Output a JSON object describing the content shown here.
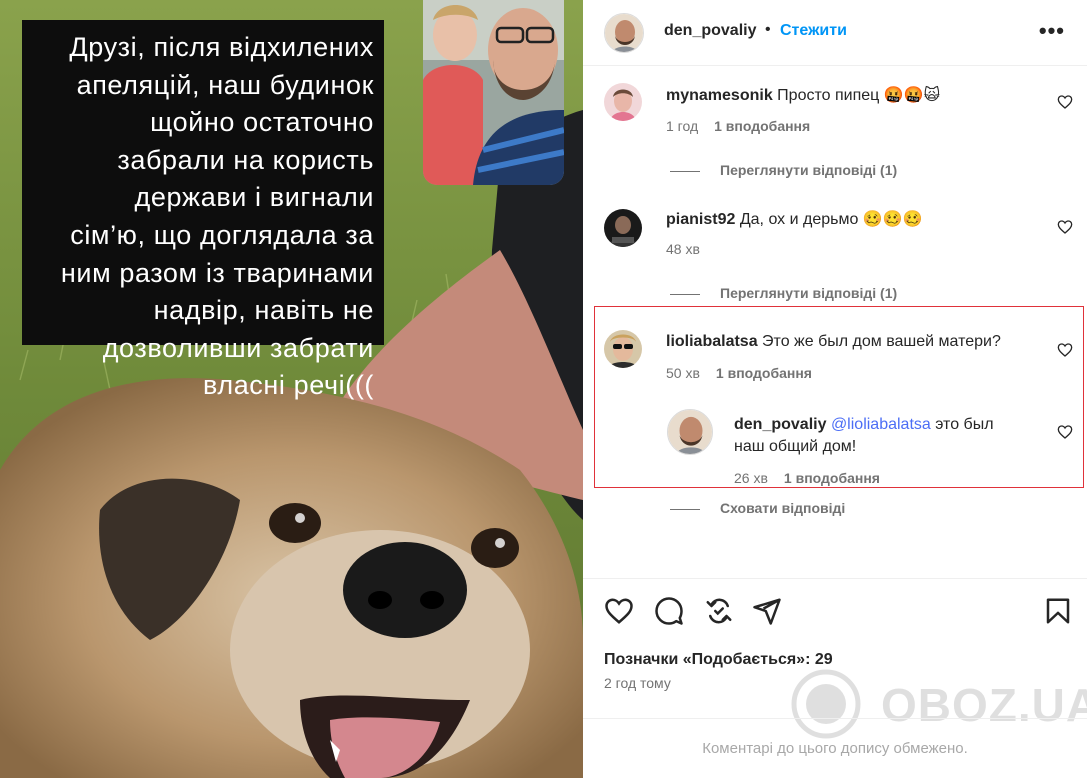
{
  "story": {
    "lines": [
      "Друзі, після відхилених",
      "апеляцій, наш будинок",
      "щойно остаточно",
      "забрали на користь",
      "держави і вигнали",
      "сім’ю, що доглядала за",
      "ним разом із тваринами",
      "надвір, навіть не",
      "дозволивши забрати",
      "власні речі((("
    ]
  },
  "header": {
    "username": "den_povaliy",
    "dot": "•",
    "follow_label": "Стежити",
    "more_label": "•••"
  },
  "comments": [
    {
      "username": "mynamesonik",
      "text": "Просто пипец 🤬🤬🙀",
      "time": "1 год",
      "likes": "1 вподобання",
      "replies_label": "Переглянути відповіді (1)"
    },
    {
      "username": "pianist92",
      "text": "Да, ох и дерьмо 🥴🥴🥴",
      "time": "48 хв",
      "likes": "",
      "replies_label": "Переглянути відповіді (1)"
    },
    {
      "username": "lioliabalatsa",
      "text": "Это же был дом вашей матери?",
      "time": "50 хв",
      "likes": "1 вподобання",
      "reply": {
        "username": "den_povaliy",
        "mention": "@lioliabalatsa",
        "text_line1": " это был",
        "text_line2": "наш общий дом!",
        "time": "26 хв",
        "likes": "1 вподобання"
      },
      "replies_label": "Сховати відповіді"
    }
  ],
  "actions": {
    "icons": [
      "heart-icon",
      "comment-icon",
      "repost-icon",
      "share-icon",
      "bookmark-icon"
    ],
    "likes_text": "Позначки «Подобається»: 29",
    "time_ago": "2 год тому",
    "limited_text": "Коментарі до цього допису обмежено."
  },
  "watermark": {
    "text": "OBOZ.UA"
  },
  "colors": {
    "accent": "#0095f6",
    "mention": "#4c6ef5",
    "highlight": "#e0323a",
    "meta": "#737373"
  }
}
